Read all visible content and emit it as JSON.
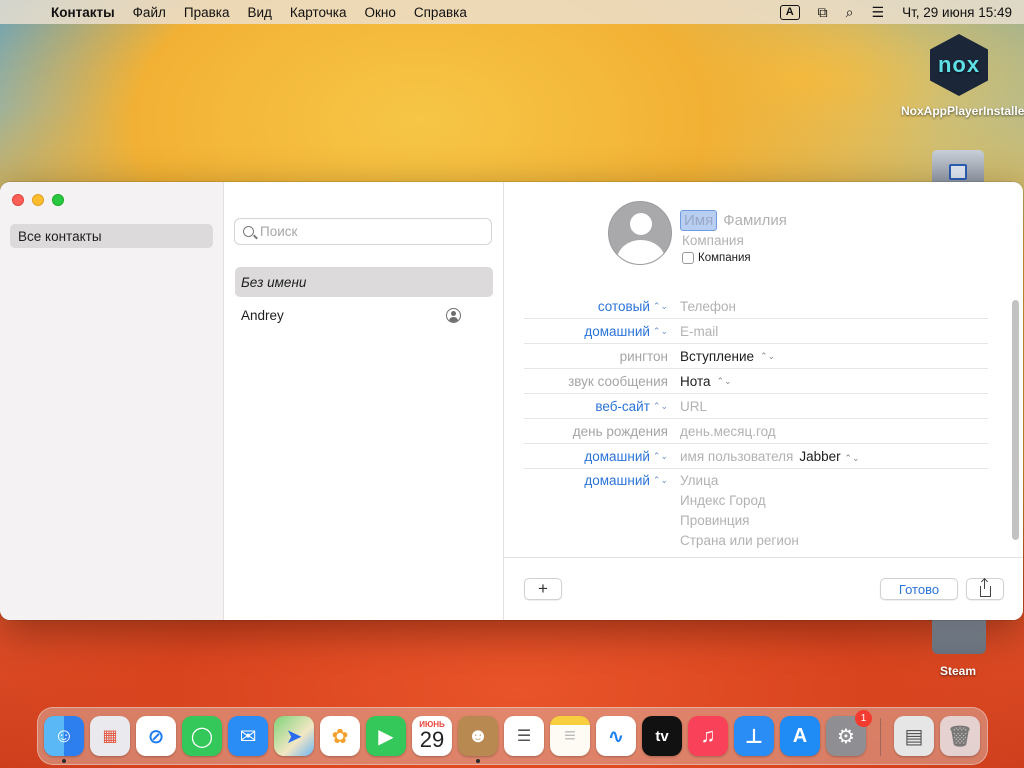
{
  "menubar": {
    "apple": "",
    "items": [
      "Контакты",
      "Файл",
      "Правка",
      "Вид",
      "Карточка",
      "Окно",
      "Справка"
    ],
    "input_indicator": "A",
    "datetime": "Чт, 29 июня  15:49"
  },
  "desktop": {
    "nox_logo": "nox",
    "nox_label": "NoxAppPlayerInstaller",
    "steam_label": "Steam"
  },
  "sidebar": {
    "group": "Все контакты"
  },
  "list": {
    "search_placeholder": "Поиск",
    "contacts": [
      "Без имени",
      "Andrey"
    ]
  },
  "card": {
    "first_name_placeholder": "Имя",
    "last_name_placeholder": "Фамилия",
    "company_placeholder": "Компания",
    "company_checkbox_label": "Компания",
    "fields": {
      "mobile": {
        "label": "сотовый",
        "value": "Телефон"
      },
      "email": {
        "label": "домашний",
        "value": "E-mail"
      },
      "ringtone": {
        "label": "рингтон",
        "value": "Вступление"
      },
      "texttone": {
        "label": "звук сообщения",
        "value": "Нота"
      },
      "website": {
        "label": "веб-сайт",
        "value": "URL"
      },
      "birthday": {
        "label": "день рождения",
        "value": "день.месяц.год"
      },
      "im": {
        "label": "домашний",
        "value": "имя пользователя",
        "service": "Jabber"
      },
      "address": {
        "label": "домашний",
        "street": "Улица",
        "zip_city": "Индекс Город",
        "province": "Провинция",
        "country": "Страна или регион"
      }
    },
    "add_button": "+",
    "done_button": "Готово"
  },
  "dock": {
    "calendar_month": "ИЮНЬ",
    "calendar_day": "29",
    "tv_label": "tv",
    "settings_badge": "1"
  }
}
